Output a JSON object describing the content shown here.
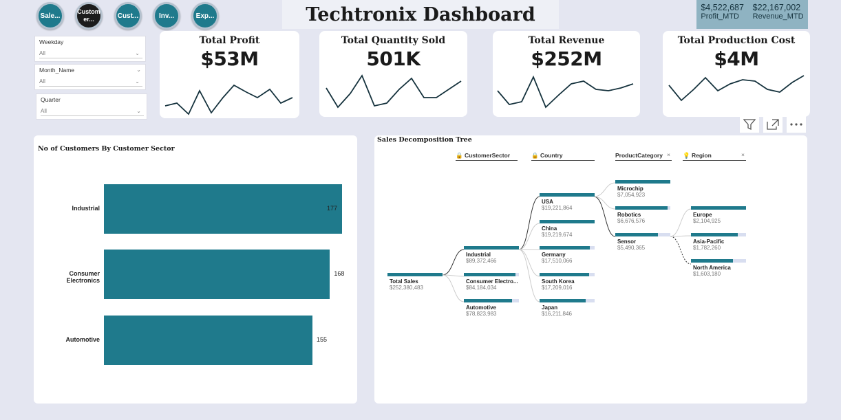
{
  "nav": [
    {
      "label": "Sale..."
    },
    {
      "label": "Custom er..."
    },
    {
      "label": "Cust..."
    },
    {
      "label": "Inv..."
    },
    {
      "label": "Exp..."
    }
  ],
  "title": "Techtronix Dashboard",
  "mtd": {
    "profit_value": "$4,522,687",
    "profit_label": "Profit_MTD",
    "revenue_value": "$22,167,002",
    "revenue_label": "Revenue_MTD"
  },
  "slicers": [
    {
      "title": "Weekday",
      "value": "All"
    },
    {
      "title": "Month_Name",
      "value": "All"
    },
    {
      "title": "Quarter",
      "value": "All"
    }
  ],
  "kpis": [
    {
      "title": "Total Profit",
      "value": "$53M"
    },
    {
      "title": "Total Quantity Sold",
      "value": "501K"
    },
    {
      "title": "Total Revenue",
      "value": "$252M"
    },
    {
      "title": "Total Production Cost",
      "value": "$4M"
    }
  ],
  "toolbar": {
    "filter_icon": "filter-icon",
    "focus_icon": "focus-mode-icon",
    "more_icon": "more-options-icon"
  },
  "customers_chart": {
    "title": "No of Customers By Customer Sector"
  },
  "chart_data": {
    "type": "bar",
    "title": "No of Customers By Customer Sector",
    "categories": [
      "Industrial",
      "Consumer Electronics",
      "Automotive"
    ],
    "values": [
      177,
      168,
      155
    ],
    "xlim": [
      0,
      177
    ]
  },
  "tree": {
    "title": "Sales Decomposition Tree",
    "headers": [
      "CustomerSector",
      "Country",
      "ProductCategory",
      "Region"
    ],
    "root": {
      "name": "Total Sales",
      "value": "$252,380,483"
    },
    "sectors": [
      {
        "name": "Industrial",
        "value": "$89,372,466",
        "frac": 1.0
      },
      {
        "name": "Consumer Electro...",
        "value": "$84,184,034",
        "frac": 0.94
      },
      {
        "name": "Automotive",
        "value": "$78,823,983",
        "frac": 0.88
      }
    ],
    "countries": [
      {
        "name": "USA",
        "value": "$19,221,864",
        "frac": 1.0
      },
      {
        "name": "China",
        "value": "$19,219,674",
        "frac": 1.0
      },
      {
        "name": "Germany",
        "value": "$17,510,066",
        "frac": 0.91
      },
      {
        "name": "South Korea",
        "value": "$17,209,016",
        "frac": 0.9
      },
      {
        "name": "Japan",
        "value": "$16,211,846",
        "frac": 0.84
      }
    ],
    "categories": [
      {
        "name": "Microchip",
        "value": "$7,054,923",
        "frac": 1.0
      },
      {
        "name": "Robotics",
        "value": "$6,676,576",
        "frac": 0.95
      },
      {
        "name": "Sensor",
        "value": "$5,490,365",
        "frac": 0.78
      }
    ],
    "regions": [
      {
        "name": "Europe",
        "value": "$2,104,925",
        "frac": 1.0
      },
      {
        "name": "Asia-Pacific",
        "value": "$1,782,260",
        "frac": 0.85
      },
      {
        "name": "North America",
        "value": "$1,603,180",
        "frac": 0.76
      }
    ]
  }
}
